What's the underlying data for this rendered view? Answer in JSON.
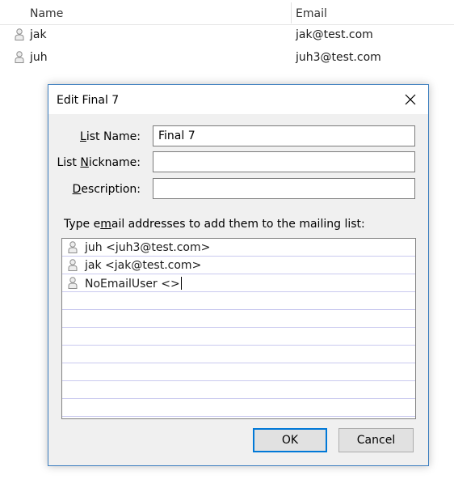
{
  "address_book": {
    "columns": {
      "name": "Name",
      "email": "Email"
    },
    "rows": [
      {
        "name": "jak",
        "email": "jak@test.com"
      },
      {
        "name": "juh",
        "email": "juh3@test.com"
      }
    ]
  },
  "dialog": {
    "title": "Edit Final 7",
    "list_name": {
      "label_pre": "",
      "label_key": "L",
      "label_post": "ist Name:",
      "value": "Final 7"
    },
    "list_nickname": {
      "label_pre": "List ",
      "label_key": "N",
      "label_post": "ickname:",
      "value": ""
    },
    "description": {
      "label_pre": "",
      "label_key": "D",
      "label_post": "escription:",
      "value": ""
    },
    "instruction": {
      "pre": "Type e",
      "key": "m",
      "post": "ail addresses to add them to the mailing list:"
    },
    "members": [
      "juh <juh3@test.com>",
      "jak <jak@test.com>",
      "NoEmailUser <>"
    ],
    "ok_label": "OK",
    "cancel_label": "Cancel"
  },
  "icons": {
    "contact": "person-icon",
    "close": "close-icon"
  },
  "colors": {
    "dialog_border": "#3c7ebf",
    "ok_focus_border": "#0078d7",
    "row_line": "#c9c9ef"
  }
}
